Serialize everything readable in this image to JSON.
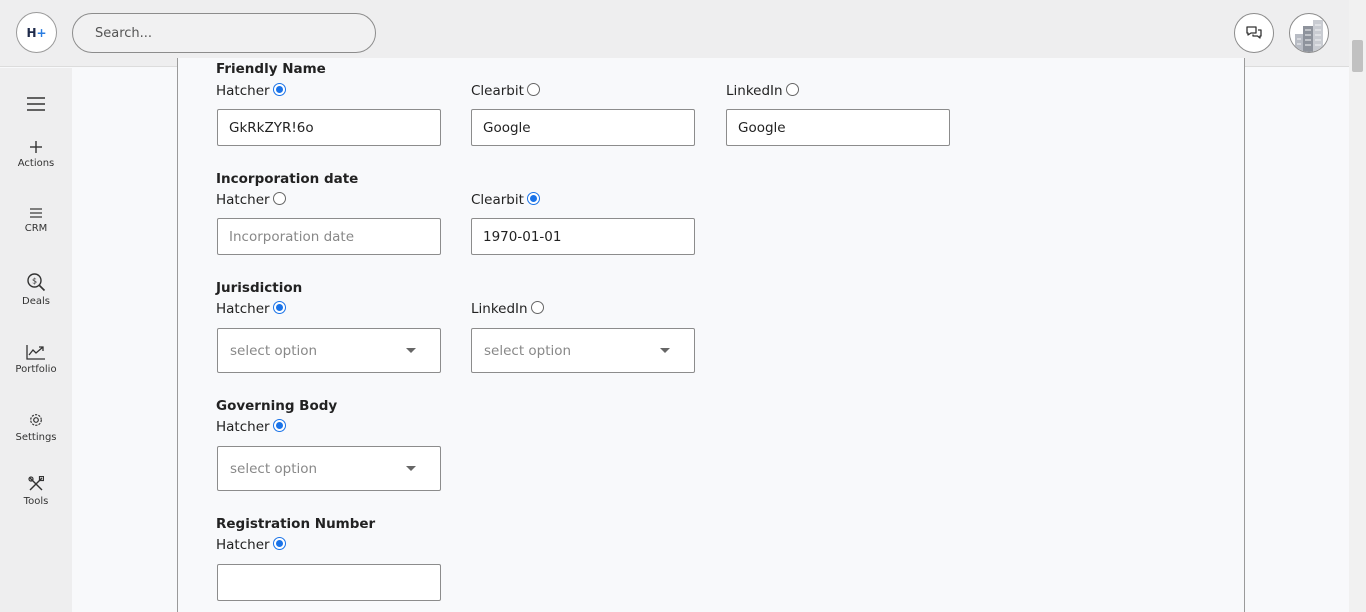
{
  "header": {
    "logo_text": "H",
    "logo_plus": "+",
    "search_placeholder": "Search...",
    "chat_icon": "chat-bubbles-icon",
    "avatar_icon": "building-icon"
  },
  "sidebar": {
    "menu_icon": "hamburger-icon",
    "items": [
      {
        "label": "Actions",
        "icon": "plus-icon"
      },
      {
        "label": "CRM",
        "icon": "lines-icon"
      },
      {
        "label": "Deals",
        "icon": "dollar-search-icon"
      },
      {
        "label": "Portfolio",
        "icon": "trend-chart-icon"
      },
      {
        "label": "Settings",
        "icon": "gear-icon"
      },
      {
        "label": "Tools",
        "icon": "tools-icon"
      }
    ]
  },
  "form": {
    "friendly_name": {
      "title": "Friendly Name",
      "sources": [
        {
          "label": "Hatcher",
          "checked": true,
          "value": "GkRkZYR!6o"
        },
        {
          "label": "Clearbit",
          "checked": false,
          "value": "Google"
        },
        {
          "label": "LinkedIn",
          "checked": false,
          "value": "Google"
        }
      ]
    },
    "incorporation_date": {
      "title": "Incorporation date",
      "sources": [
        {
          "label": "Hatcher",
          "checked": false,
          "value": "",
          "placeholder": "Incorporation date"
        },
        {
          "label": "Clearbit",
          "checked": true,
          "value": "1970-01-01"
        }
      ]
    },
    "jurisdiction": {
      "title": "Jurisdiction",
      "sources": [
        {
          "label": "Hatcher",
          "checked": true,
          "placeholder": "select option"
        },
        {
          "label": "LinkedIn",
          "checked": false,
          "placeholder": "select option"
        }
      ]
    },
    "governing_body": {
      "title": "Governing Body",
      "sources": [
        {
          "label": "Hatcher",
          "checked": true,
          "placeholder": "select option"
        }
      ]
    },
    "registration_number": {
      "title": "Registration Number",
      "sources": [
        {
          "label": "Hatcher",
          "checked": true,
          "value": ""
        }
      ]
    }
  },
  "colors": {
    "accent": "#1a73e8",
    "chrome_bg": "#eeeeef",
    "page_bg": "#f8f9fb",
    "border": "#8c8c8c"
  }
}
